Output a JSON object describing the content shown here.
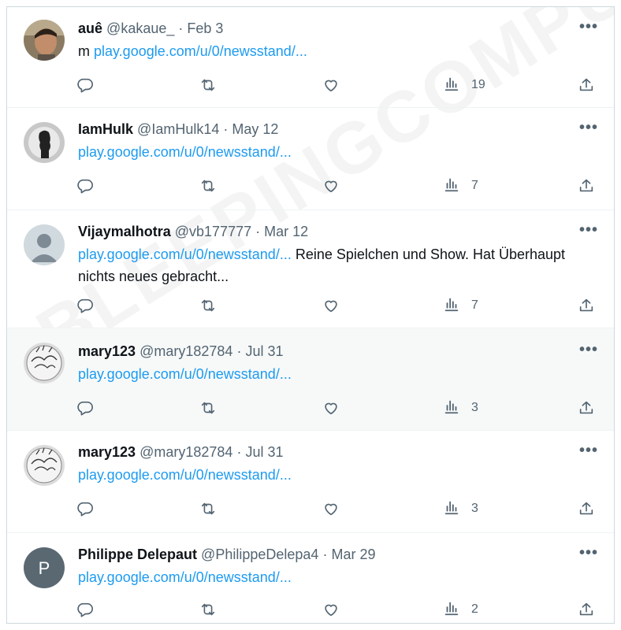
{
  "colors": {
    "link": "#1d9bf0",
    "muted": "#536471",
    "text": "#0f1419"
  },
  "icons": {
    "reply": "reply-icon",
    "retweet": "retweet-icon",
    "like": "heart-icon",
    "views": "views-icon",
    "share": "share-icon",
    "more": "more-icon"
  },
  "more_label": "•••",
  "watermark": "BLEEPINGCOMPUTER",
  "tweets": [
    {
      "name": "auê",
      "handle": "@kakaue_",
      "sep": "·",
      "date": "Feb 3",
      "prefix": "m ",
      "link": "play.google.com/u/0/newsstand/...",
      "suffix": "",
      "views": "19",
      "avatar": "photo"
    },
    {
      "name": "IamHulk",
      "handle": "@IamHulk14",
      "sep": "·",
      "date": "May 12",
      "prefix": "",
      "link": "play.google.com/u/0/newsstand/...",
      "suffix": "",
      "views": "7",
      "avatar": "silhouette"
    },
    {
      "name": "Vijaymalhotra",
      "handle": "@vb177777",
      "sep": "·",
      "date": "Mar 12",
      "prefix": "",
      "link": "play.google.com/u/0/newsstand/...",
      "suffix": "  Reine Spielchen und Show. Hat Überhaupt nichts neues gebracht...",
      "views": "7",
      "avatar": "default"
    },
    {
      "name": "mary123",
      "handle": "@mary182784",
      "sep": "·",
      "date": "Jul 31",
      "prefix": "",
      "link": "play.google.com/u/0/newsstand/...",
      "suffix": "",
      "views": "3",
      "avatar": "sketch"
    },
    {
      "name": "mary123",
      "handle": "@mary182784",
      "sep": "·",
      "date": "Jul 31",
      "prefix": "",
      "link": "play.google.com/u/0/newsstand/...",
      "suffix": "",
      "views": "3",
      "avatar": "sketch"
    },
    {
      "name": "Philippe Delepaut",
      "handle": "@PhilippeDelepa4",
      "sep": "·",
      "date": "Mar 29",
      "prefix": "",
      "link": "play.google.com/u/0/newsstand/...",
      "suffix": "",
      "views": "2",
      "avatar": "initial",
      "initial": "P"
    }
  ]
}
